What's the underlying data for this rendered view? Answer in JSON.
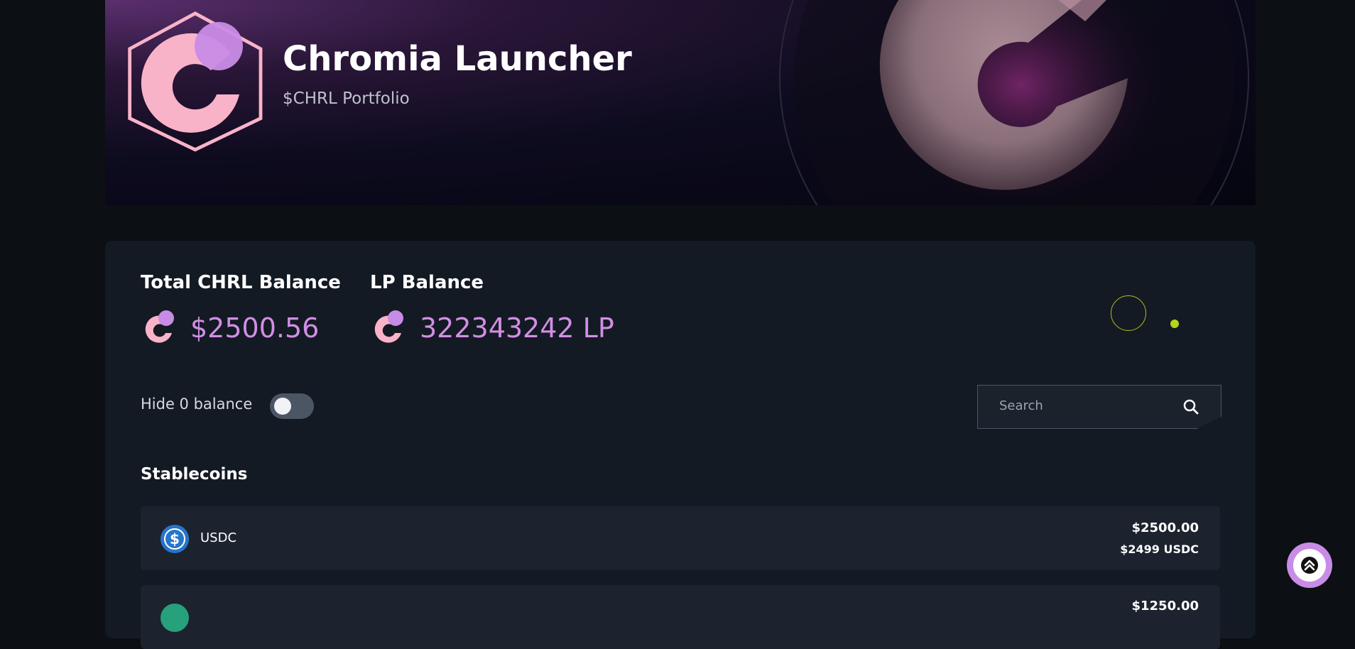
{
  "header": {
    "title": "Chromia Launcher",
    "subtitle": "$CHRL Portfolio"
  },
  "balances": {
    "total_label": "Total CHRL Balance",
    "total_value": "$2500.56",
    "lp_label": "LP Balance",
    "lp_value": "322343242 LP"
  },
  "filters": {
    "hide_zero_label": "Hide 0 balance",
    "hide_zero_enabled": false,
    "search_placeholder": "Search"
  },
  "stablecoins": {
    "title": "Stablecoins",
    "items": [
      {
        "name": "USDC",
        "usd_value": "$2500.00",
        "amount": "$2499 USDC",
        "icon": "usdc-icon",
        "color": "#2775ca"
      },
      {
        "name": "",
        "usd_value": "$1250.00",
        "amount": "",
        "icon": "usdt-icon",
        "color": "#26a17b"
      }
    ]
  },
  "colors": {
    "accent": "#d38ee6",
    "logo_pink": "#f9b3c8",
    "logo_purple": "#c98ce6",
    "loader": "#a5c21a"
  }
}
